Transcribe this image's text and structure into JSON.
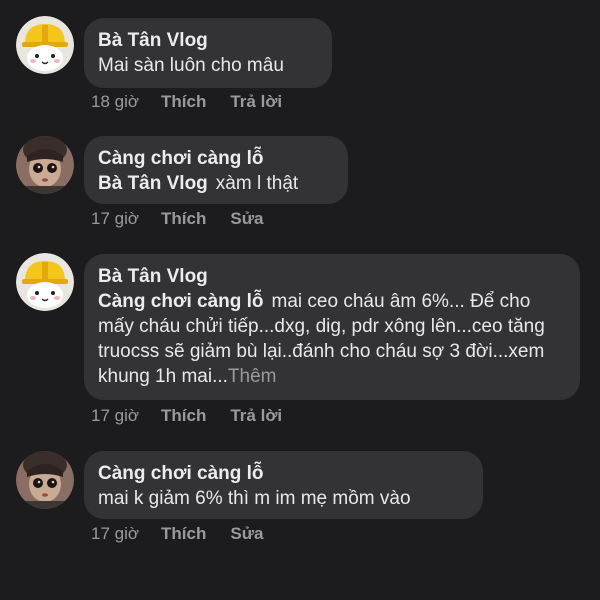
{
  "comments": [
    {
      "author": "Bà Tân Vlog",
      "avatar": "yellow-helmet-avatar",
      "mention": "",
      "text": "Mai sàn luôn cho mâu",
      "more": "",
      "time": "18 giờ",
      "like": "Thích",
      "action": "Trả lời"
    },
    {
      "author": "Càng chơi càng lỗ",
      "avatar": "doll-avatar",
      "mention": "Bà Tân Vlog",
      "text": "xàm l thật",
      "more": "",
      "time": "17 giờ",
      "like": "Thích",
      "action": "Sửa"
    },
    {
      "author": "Bà Tân Vlog",
      "avatar": "yellow-helmet-avatar",
      "mention": "Càng chơi càng lỗ",
      "text": "mai ceo cháu âm 6%... Để cho mấy cháu chửi tiếp...dxg, dig, pdr xông lên...ceo tăng truocss sẽ giảm bù lại..đánh cho cháu sợ 3 đời...xem khung 1h mai...",
      "more": "Thêm",
      "time": "17 giờ",
      "like": "Thích",
      "action": "Trả lời"
    },
    {
      "author": "Càng chơi càng lỗ",
      "avatar": "doll-avatar",
      "mention": "",
      "text": "mai k giảm 6% thì m im mẹ mồm vào",
      "more": "",
      "time": "17 giờ",
      "like": "Thích",
      "action": "Sửa"
    }
  ],
  "colors": {
    "background": "#1c1c1e",
    "bubble": "#333336",
    "meta": "#9a9a9e",
    "helmet": "#f4c51a"
  }
}
